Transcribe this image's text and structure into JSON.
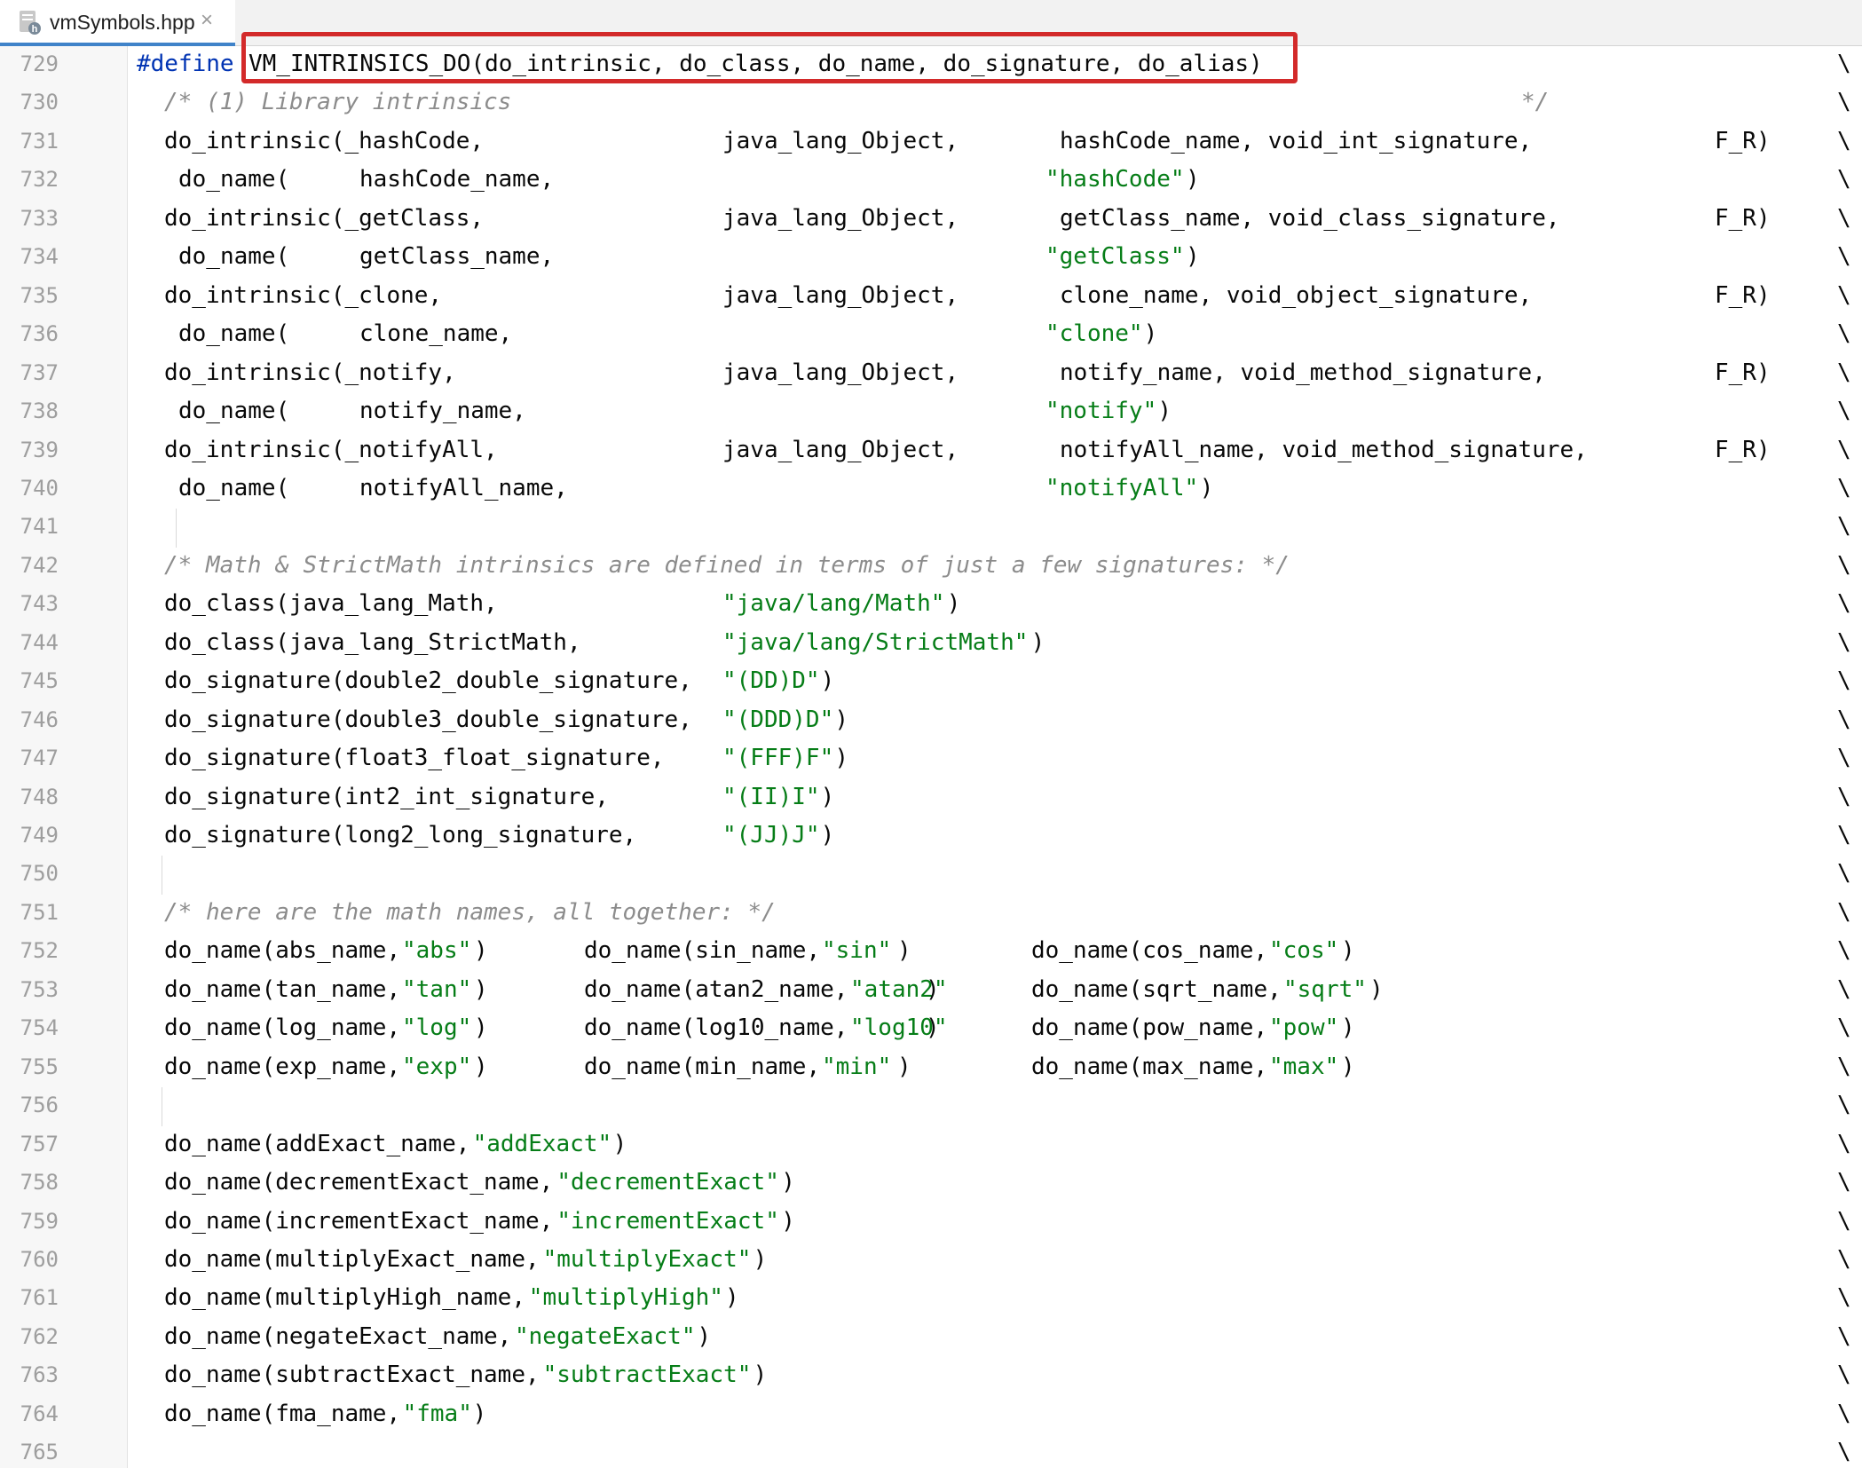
{
  "tab": {
    "filename": "vmSymbols.hpp",
    "close": "×",
    "icon": "header-file-icon"
  },
  "highlight": {
    "color": "#d32a2a",
    "target": "VM_INTRINSICS_DO(do_intrinsic, do_class, do_name, do_signature, do_alias)"
  },
  "syntax_colors": {
    "keyword": "#0033b3",
    "string": "#067d17",
    "comment": "#8c8c8c",
    "text": "#080808",
    "line_number": "#9e9e9e"
  },
  "continuation": "\\",
  "lines": [
    {
      "num": "729",
      "segs": [
        {
          "t": "#define",
          "c": "kw"
        },
        {
          "t": "VM_INTRINSICS_DO(do_intrinsic, do_class, do_name, do_signature, do_alias)"
        }
      ]
    },
    {
      "num": "730",
      "segs": [
        {
          "t": "/* (1) Library intrinsics",
          "c": "cmt"
        },
        {
          "t": "*/",
          "c": "cmt"
        }
      ]
    },
    {
      "num": "731",
      "segs": [
        {
          "t": "do_intrinsic(_hashCode,"
        },
        {
          "t": "java_lang_Object,"
        },
        {
          "t": "hashCode_name, void_int_signature,"
        },
        {
          "t": "F_R)"
        }
      ]
    },
    {
      "num": "732",
      "segs": [
        {
          "t": "do_name("
        },
        {
          "t": "hashCode_name,"
        },
        {
          "t": "\"hashCode\"",
          "c": "str"
        },
        {
          "t": ")"
        }
      ]
    },
    {
      "num": "733",
      "segs": [
        {
          "t": "do_intrinsic(_getClass,"
        },
        {
          "t": "java_lang_Object,"
        },
        {
          "t": "getClass_name, void_class_signature,"
        },
        {
          "t": "F_R)"
        }
      ]
    },
    {
      "num": "734",
      "segs": [
        {
          "t": "do_name("
        },
        {
          "t": "getClass_name,"
        },
        {
          "t": "\"getClass\"",
          "c": "str"
        },
        {
          "t": ")"
        }
      ]
    },
    {
      "num": "735",
      "segs": [
        {
          "t": "do_intrinsic(_clone,"
        },
        {
          "t": "java_lang_Object,"
        },
        {
          "t": "clone_name, void_object_signature,"
        },
        {
          "t": "F_R)"
        }
      ]
    },
    {
      "num": "736",
      "segs": [
        {
          "t": "do_name("
        },
        {
          "t": "clone_name,"
        },
        {
          "t": "\"clone\"",
          "c": "str"
        },
        {
          "t": ")"
        }
      ]
    },
    {
      "num": "737",
      "segs": [
        {
          "t": "do_intrinsic(_notify,"
        },
        {
          "t": "java_lang_Object,"
        },
        {
          "t": "notify_name, void_method_signature,"
        },
        {
          "t": "F_R)"
        }
      ]
    },
    {
      "num": "738",
      "segs": [
        {
          "t": "do_name("
        },
        {
          "t": "notify_name,"
        },
        {
          "t": "\"notify\"",
          "c": "str"
        },
        {
          "t": ")"
        }
      ]
    },
    {
      "num": "739",
      "segs": [
        {
          "t": "do_intrinsic(_notifyAll,"
        },
        {
          "t": "java_lang_Object,"
        },
        {
          "t": "notifyAll_name, void_method_signature,"
        },
        {
          "t": "F_R)"
        }
      ]
    },
    {
      "num": "740",
      "segs": [
        {
          "t": "do_name("
        },
        {
          "t": "notifyAll_name,"
        },
        {
          "t": "\"notifyAll\"",
          "c": "str"
        },
        {
          "t": ")"
        }
      ]
    },
    {
      "num": "741",
      "segs": []
    },
    {
      "num": "742",
      "segs": [
        {
          "t": "/* Math & StrictMath intrinsics are defined in terms of just a few signatures: */",
          "c": "cmt"
        }
      ]
    },
    {
      "num": "743",
      "segs": [
        {
          "t": "do_class(java_lang_Math,"
        },
        {
          "t": "\"java/lang/Math\"",
          "c": "str"
        },
        {
          "t": ")"
        }
      ]
    },
    {
      "num": "744",
      "segs": [
        {
          "t": "do_class(java_lang_StrictMath,"
        },
        {
          "t": "\"java/lang/StrictMath\"",
          "c": "str"
        },
        {
          "t": ")"
        }
      ]
    },
    {
      "num": "745",
      "segs": [
        {
          "t": "do_signature(double2_double_signature,"
        },
        {
          "t": "\"(DD)D\"",
          "c": "str"
        },
        {
          "t": ")"
        }
      ]
    },
    {
      "num": "746",
      "segs": [
        {
          "t": "do_signature(double3_double_signature,"
        },
        {
          "t": "\"(DDD)D\"",
          "c": "str"
        },
        {
          "t": ")"
        }
      ]
    },
    {
      "num": "747",
      "segs": [
        {
          "t": "do_signature(float3_float_signature,"
        },
        {
          "t": "\"(FFF)F\"",
          "c": "str"
        },
        {
          "t": ")"
        }
      ]
    },
    {
      "num": "748",
      "segs": [
        {
          "t": "do_signature(int2_int_signature,"
        },
        {
          "t": "\"(II)I\"",
          "c": "str"
        },
        {
          "t": ")"
        }
      ]
    },
    {
      "num": "749",
      "segs": [
        {
          "t": "do_signature(long2_long_signature,"
        },
        {
          "t": "\"(JJ)J\"",
          "c": "str"
        },
        {
          "t": ")"
        }
      ]
    },
    {
      "num": "750",
      "segs": []
    },
    {
      "num": "751",
      "segs": [
        {
          "t": "/* here are the math names, all together: */",
          "c": "cmt"
        }
      ]
    },
    {
      "num": "752",
      "segs": [
        {
          "t": "do_name(abs_name,"
        },
        {
          "t": "\"abs\"",
          "c": "str"
        },
        {
          "t": ")"
        },
        {
          "t": "do_name(sin_name,"
        },
        {
          "t": "\"sin\"",
          "c": "str"
        },
        {
          "t": ")"
        },
        {
          "t": "do_name(cos_name,"
        },
        {
          "t": "\"cos\"",
          "c": "str"
        },
        {
          "t": ")"
        }
      ]
    },
    {
      "num": "753",
      "segs": [
        {
          "t": "do_name(tan_name,"
        },
        {
          "t": "\"tan\"",
          "c": "str"
        },
        {
          "t": ")"
        },
        {
          "t": "do_name(atan2_name,"
        },
        {
          "t": "\"atan2\"",
          "c": "str"
        },
        {
          "t": ")"
        },
        {
          "t": "do_name(sqrt_name,"
        },
        {
          "t": "\"sqrt\"",
          "c": "str"
        },
        {
          "t": ")"
        }
      ]
    },
    {
      "num": "754",
      "segs": [
        {
          "t": "do_name(log_name,"
        },
        {
          "t": "\"log\"",
          "c": "str"
        },
        {
          "t": ")"
        },
        {
          "t": "do_name(log10_name,"
        },
        {
          "t": "\"log10\"",
          "c": "str"
        },
        {
          "t": ")"
        },
        {
          "t": "do_name(pow_name,"
        },
        {
          "t": "\"pow\"",
          "c": "str"
        },
        {
          "t": ")"
        }
      ]
    },
    {
      "num": "755",
      "segs": [
        {
          "t": "do_name(exp_name,"
        },
        {
          "t": "\"exp\"",
          "c": "str"
        },
        {
          "t": ")"
        },
        {
          "t": "do_name(min_name,"
        },
        {
          "t": "\"min\"",
          "c": "str"
        },
        {
          "t": ")"
        },
        {
          "t": "do_name(max_name,"
        },
        {
          "t": "\"max\"",
          "c": "str"
        },
        {
          "t": ")"
        }
      ]
    },
    {
      "num": "756",
      "segs": []
    },
    {
      "num": "757",
      "segs": [
        {
          "t": "do_name(addExact_name,"
        },
        {
          "t": "\"addExact\"",
          "c": "str"
        },
        {
          "t": ")"
        }
      ]
    },
    {
      "num": "758",
      "segs": [
        {
          "t": "do_name(decrementExact_name,"
        },
        {
          "t": "\"decrementExact\"",
          "c": "str"
        },
        {
          "t": ")"
        }
      ]
    },
    {
      "num": "759",
      "segs": [
        {
          "t": "do_name(incrementExact_name,"
        },
        {
          "t": "\"incrementExact\"",
          "c": "str"
        },
        {
          "t": ")"
        }
      ]
    },
    {
      "num": "760",
      "segs": [
        {
          "t": "do_name(multiplyExact_name,"
        },
        {
          "t": "\"multiplyExact\"",
          "c": "str"
        },
        {
          "t": ")"
        }
      ]
    },
    {
      "num": "761",
      "segs": [
        {
          "t": "do_name(multiplyHigh_name,"
        },
        {
          "t": "\"multiplyHigh\"",
          "c": "str"
        },
        {
          "t": ")"
        }
      ]
    },
    {
      "num": "762",
      "segs": [
        {
          "t": "do_name(negateExact_name,"
        },
        {
          "t": "\"negateExact\"",
          "c": "str"
        },
        {
          "t": ")"
        }
      ]
    },
    {
      "num": "763",
      "segs": [
        {
          "t": "do_name(subtractExact_name,"
        },
        {
          "t": "\"subtractExact\"",
          "c": "str"
        },
        {
          "t": ")"
        }
      ]
    },
    {
      "num": "764",
      "segs": [
        {
          "t": "do_name(fma_name,"
        },
        {
          "t": "\"fma\"",
          "c": "str"
        },
        {
          "t": ")"
        }
      ]
    },
    {
      "num": "765",
      "segs": []
    }
  ]
}
